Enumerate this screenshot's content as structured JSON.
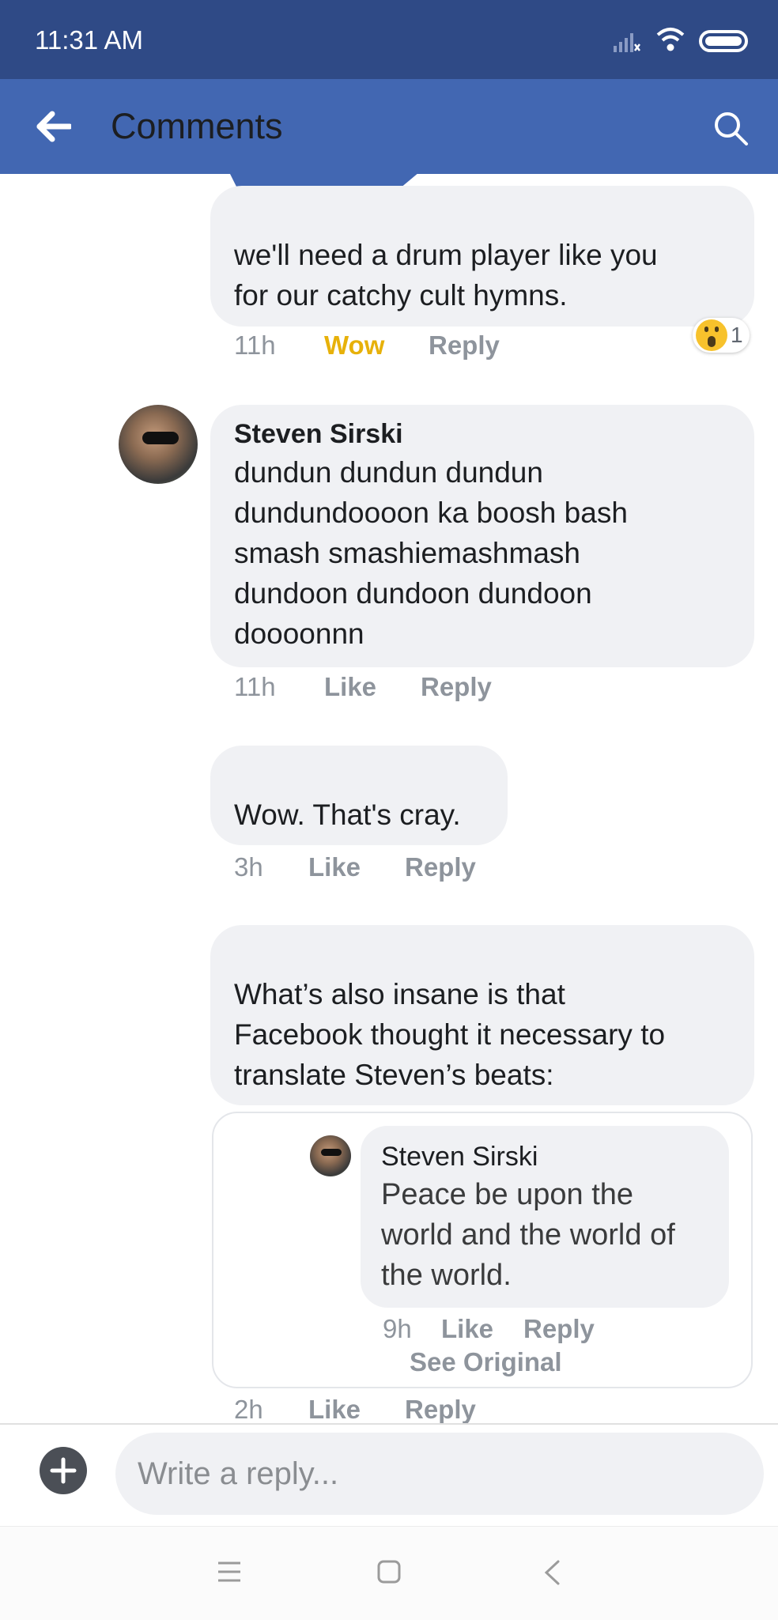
{
  "status": {
    "time": "11:31 AM"
  },
  "header": {
    "title": "Comments"
  },
  "comments": [
    {
      "text_line1": "we'll need a drum player like you",
      "text_line2": "for our catchy cult hymns.",
      "time": "11h",
      "like_label": "Wow",
      "reply_label": "Reply",
      "reaction_count": "1",
      "reaction_color": "#e7b10a"
    },
    {
      "author": "Steven Sirski",
      "lines": [
        "dundun dundun dundun",
        "dundundoooon ka boosh bash",
        "smash smashiemashmash",
        "dundoon dundoon dundoon",
        "doooonnn"
      ],
      "time": "11h",
      "like_label": "Like",
      "reply_label": "Reply"
    },
    {
      "text": "Wow. That's cray.",
      "time": "3h",
      "like_label": "Like",
      "reply_label": "Reply"
    },
    {
      "lines": [
        "What’s also insane is that",
        "Facebook thought it necessary to",
        "translate Steven’s beats:"
      ],
      "time": "2h",
      "like_label": "Like",
      "reply_label": "Reply",
      "embedded": {
        "author": "Steven Sirski",
        "lines": [
          "Peace be upon the",
          "world and the world of",
          "the world."
        ],
        "time": "9h",
        "like_label": "Like",
        "reply_label": "Reply",
        "see_original": "See Original"
      }
    }
  ],
  "composer": {
    "placeholder": "Write a reply..."
  },
  "colors": {
    "status_bar": "#2f4a86",
    "header": "#4267b2",
    "bubble": "#f0f1f4",
    "meta": "#8e949c"
  }
}
